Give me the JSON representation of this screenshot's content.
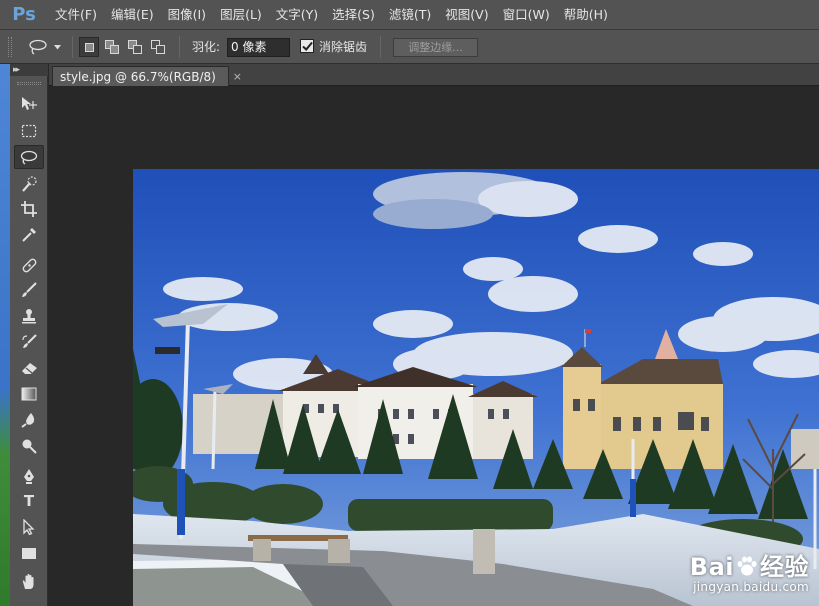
{
  "app": {
    "logo": "Ps"
  },
  "menu": [
    "文件(F)",
    "编辑(E)",
    "图像(I)",
    "图层(L)",
    "文字(Y)",
    "选择(S)",
    "滤镜(T)",
    "视图(V)",
    "窗口(W)",
    "帮助(H)"
  ],
  "options": {
    "feather_label": "羽化:",
    "feather_value": "0 像素",
    "antialias_label": "消除锯齿",
    "antialias_checked": true,
    "refine_edge_label": "调整边缘..."
  },
  "document": {
    "tab_title": "style.jpg @ 66.7%(RGB/8)",
    "close_symbol": "×"
  },
  "tools": [
    "move-tool",
    "marquee-tool",
    "lasso-tool",
    "quick-selection-tool",
    "crop-tool",
    "eyedropper-tool",
    "healing-brush-tool",
    "brush-tool",
    "clone-stamp-tool",
    "history-brush-tool",
    "eraser-tool",
    "gradient-tool",
    "blur-tool",
    "dodge-tool",
    "pen-tool",
    "type-tool",
    "path-selection-tool",
    "rectangle-tool",
    "hand-tool"
  ],
  "active_tool": "lasso-tool",
  "watermark": {
    "brand": "Bai",
    "brand_suffix": "经验",
    "url": "jingyan.baidu.com"
  },
  "colors": {
    "chrome": "#535353",
    "workspace": "#282828",
    "accent_logo": "#6aa4d8",
    "sky": "#2f5fc4"
  }
}
